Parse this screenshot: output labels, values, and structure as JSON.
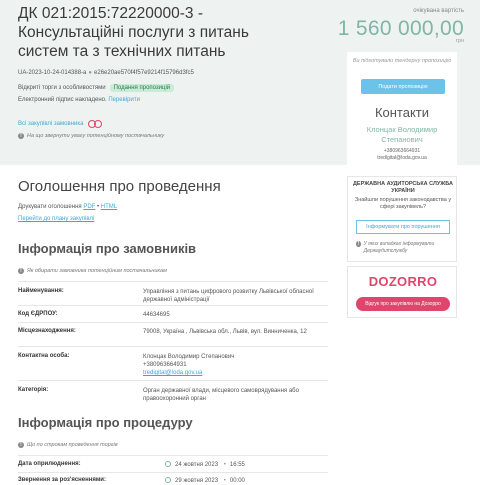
{
  "tender": {
    "title": "ДК 021:2015:72220000-3 - Консультаційні послуги з питань систем та з технічних питань",
    "id": "UA-2023-10-24-014388-a",
    "hash": "e26e20ae570f4f57e9214f15796d3fc5",
    "procedure_label": "Відкриті торги з особливостями",
    "status_badge": "Подання пропозицій",
    "signature_label": "Електронний підпис накладено.",
    "signature_link": "Перевірити",
    "all_purchases_link": "Всі закупівлі замовника",
    "attention_hint": "На що звернути увагу потенційному постачальнику"
  },
  "price": {
    "label": "очікувана вартість",
    "value": "1 560 000,00",
    "currency": "грн"
  },
  "card": {
    "note": "Ви підготували тендерну пропозицію",
    "submit_button": "Подати пропозицію",
    "contacts_title": "Контакти",
    "contact_name": "Клонцак Володимир Степанович",
    "contact_phone": "+380963664931",
    "contact_email": "tredigital@loda.gov.ua"
  },
  "audit": {
    "title": "ДЕРЖАВНА АУДИТОРСЬКА СЛУЖБА УКРАЇНИ",
    "question": "Знайшли порушення законодавства у сфері закупівель?",
    "button": "Інформувати про порушення",
    "note": "У яких випадках інформувати Держаудитслужбу"
  },
  "dozorro": {
    "logo": "DOZORRO",
    "button": "Відгук про закупівлю на Дозорро"
  },
  "announcement": {
    "title": "Оголошення про проведення",
    "print_label": "Друкувати оголошення",
    "print_pdf": "PDF",
    "print_sep": "•",
    "print_html": "HTML",
    "plan_link": "Перейти до плану закупівлі"
  },
  "customer": {
    "title": "Інформація про замовників",
    "hint": "Як обирати замовника потенційним постачальникам",
    "rows": [
      {
        "label": "Найменування:",
        "value": "Управління з питань цифрового розвитку Львівської обласної державної адміністрації"
      },
      {
        "label": "Код ЄДРПОУ:",
        "value": "44634695"
      },
      {
        "label": "Місцезнаходження:",
        "value": "79008, Україна , Львівська обл., Львів, вул. Винниченка, 12"
      },
      {
        "label": "Контактна особа:",
        "value": "Клонцак Володимир Степанович",
        "phone": "+380963664931",
        "email": "tredigital@loda.gov.ua"
      },
      {
        "label": "Категорія:",
        "value": "Орган державної влади, місцевого самоврядування або правоохоронний орган"
      }
    ]
  },
  "procedure": {
    "title": "Інформація про процедуру",
    "hint": "Що по строкам проведення торгів",
    "rows": [
      {
        "label": "Дата оприлюднення:",
        "date": "24 жовтня 2023",
        "time": "16:55"
      },
      {
        "label": "Звернення за роз'ясненнями:",
        "date": "29 жовтня 2023",
        "time": "00:00"
      }
    ]
  }
}
